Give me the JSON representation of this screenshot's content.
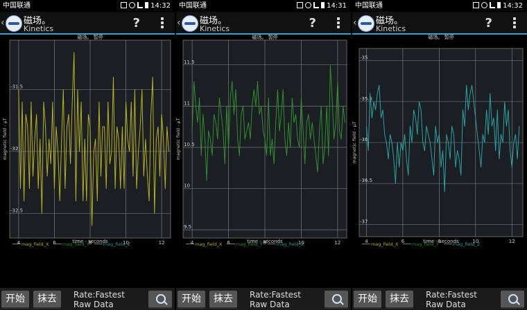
{
  "screens": [
    {
      "status": {
        "carrier": "中国联通",
        "time": "14:32"
      },
      "app": {
        "title": "磁场。",
        "subtitle": "Kinetics"
      },
      "chart_data": {
        "type": "line",
        "title": "磁场。 暂停",
        "xlabel": "time - seconds",
        "ylabel": "magnetic field - µT",
        "xlim": [
          3.5,
          12.5
        ],
        "ylim": [
          -32.7,
          -31.1
        ],
        "xticks": [
          4,
          6,
          8,
          10,
          12
        ],
        "yticks": [
          -31.5,
          -32,
          -32.5
        ],
        "ytick_labels": [
          "-31.5",
          "-32",
          "-32.5"
        ],
        "legend": [
          "mag_field_X",
          "mag_field_Y",
          "mag_field_Z"
        ],
        "series": [
          {
            "name": "mag_field_X",
            "color": "#b7b21f",
            "x": [
              4.0,
              4.1,
              4.2,
              4.3,
              4.4,
              4.5,
              4.6,
              4.7,
              4.8,
              4.9,
              5.0,
              5.1,
              5.2,
              5.3,
              5.4,
              5.5,
              5.6,
              5.7,
              5.8,
              5.9,
              6.0,
              6.1,
              6.2,
              6.3,
              6.4,
              6.5,
              6.6,
              6.7,
              6.8,
              6.9,
              7.0,
              7.1,
              7.2,
              7.3,
              7.4,
              7.5,
              7.6,
              7.7,
              7.8,
              7.9,
              8.0,
              8.1,
              8.2,
              8.3,
              8.4,
              8.5,
              8.6,
              8.7,
              8.8,
              8.9,
              9.0,
              9.1,
              9.2,
              9.3,
              9.4,
              9.5,
              9.6,
              9.7,
              9.8,
              9.9,
              10.0,
              10.1,
              10.2,
              10.3,
              10.4,
              10.5,
              10.6,
              10.7,
              10.8,
              10.9,
              11.0,
              11.1,
              11.2,
              11.3,
              11.4,
              11.5,
              11.6,
              11.7,
              11.8,
              11.9,
              12.0,
              12.1,
              12.2,
              12.3,
              12.4
            ],
            "y": [
              -31.5,
              -32.3,
              -31.6,
              -32.4,
              -31.7,
              -31.8,
              -32.3,
              -31.6,
              -32.2,
              -31.9,
              -31.7,
              -32.3,
              -31.9,
              -32.5,
              -31.6,
              -31.8,
              -32.2,
              -31.9,
              -32.1,
              -31.6,
              -32.3,
              -31.8,
              -32.0,
              -32.4,
              -31.9,
              -31.5,
              -32.3,
              -31.8,
              -31.7,
              -32.1,
              -31.6,
              -31.2,
              -32.4,
              -31.5,
              -32.0,
              -31.6,
              -32.4,
              -31.9,
              -32.4,
              -31.7,
              -31.8,
              -32.6,
              -32.0,
              -31.9,
              -32.4,
              -31.6,
              -32.2,
              -31.8,
              -31.8,
              -32.3,
              -31.6,
              -32.1,
              -32.0,
              -31.4,
              -32.3,
              -31.8,
              -31.9,
              -32.3,
              -31.8,
              -32.3,
              -31.6,
              -31.9,
              -32.0,
              -31.6,
              -32.2,
              -31.5,
              -32.3,
              -32.0,
              -31.8,
              -31.5,
              -32.2,
              -31.9,
              -32.2,
              -32.4,
              -31.7,
              -31.4,
              -32.5,
              -31.9,
              -31.8,
              -32.2,
              -31.7,
              -31.9,
              -32.3,
              -31.8,
              -32.0
            ]
          },
          {
            "name": "mag_field_Y",
            "color": "#2a8a2a",
            "x": [],
            "y": []
          },
          {
            "name": "mag_field_Z",
            "color": "#2a9a9a",
            "x": [],
            "y": []
          }
        ]
      },
      "controls": {
        "start": "开始",
        "clear": "抹去",
        "rate": "Rate:Fastest",
        "mode": "Raw Data"
      }
    },
    {
      "status": {
        "carrier": "中国联通",
        "time": "14:31"
      },
      "app": {
        "title": "磁场。",
        "subtitle": "Kinetics"
      },
      "chart_data": {
        "type": "line",
        "title": "磁场。 暂停",
        "xlabel": "time - seconds",
        "ylabel": "magnetic field - µT",
        "xlim": [
          3.5,
          12.5
        ],
        "ylim": [
          9.4,
          11.8
        ],
        "xticks": [
          4,
          6,
          8,
          10,
          12
        ],
        "yticks": [
          11.5,
          11,
          10.5,
          10,
          9.5
        ],
        "ytick_labels": [
          "11.5",
          "11",
          "10.5",
          "10",
          "9.5"
        ],
        "legend": [
          "mag_field_X",
          "mag_field_Y",
          "mag_field_Z"
        ],
        "series": [
          {
            "name": "mag_field_X",
            "color": "#b7b21f",
            "x": [],
            "y": []
          },
          {
            "name": "mag_field_Y",
            "color": "#2f8f2f",
            "x": [
              4.0,
              4.1,
              4.2,
              4.3,
              4.4,
              4.5,
              4.6,
              4.7,
              4.8,
              4.9,
              5.0,
              5.1,
              5.2,
              5.3,
              5.4,
              5.5,
              5.6,
              5.7,
              5.8,
              5.9,
              6.0,
              6.1,
              6.2,
              6.3,
              6.4,
              6.5,
              6.6,
              6.7,
              6.8,
              6.9,
              7.0,
              7.1,
              7.2,
              7.3,
              7.4,
              7.5,
              7.6,
              7.7,
              7.8,
              7.9,
              8.0,
              8.1,
              8.2,
              8.3,
              8.4,
              8.5,
              8.6,
              8.7,
              8.8,
              8.9,
              9.0,
              9.1,
              9.2,
              9.3,
              9.4,
              9.5,
              9.6,
              9.7,
              9.8,
              9.9,
              10.0,
              10.1,
              10.2,
              10.3,
              10.4,
              10.5,
              10.6,
              10.7,
              10.8,
              10.9,
              11.0,
              11.1,
              11.2,
              11.3,
              11.4,
              11.5,
              11.6,
              11.7,
              11.8,
              11.9,
              12.0,
              12.1,
              12.2,
              12.3,
              12.4
            ],
            "y": [
              10.7,
              11.3,
              11.0,
              10.8,
              11.1,
              10.4,
              10.9,
              10.6,
              10.1,
              10.7,
              10.6,
              10.4,
              10.9,
              10.8,
              10.6,
              11.1,
              10.9,
              10.7,
              10.3,
              11.0,
              10.5,
              11.1,
              11.3,
              10.9,
              11.2,
              10.6,
              10.4,
              10.9,
              11.0,
              10.6,
              10.7,
              10.8,
              10.6,
              11.0,
              11.2,
              11.0,
              11.3,
              10.9,
              11.0,
              10.7,
              10.6,
              10.4,
              11.1,
              10.4,
              10.6,
              10.3,
              10.8,
              11.2,
              10.7,
              10.9,
              11.2,
              10.6,
              10.4,
              10.8,
              10.5,
              11.1,
              10.8,
              10.9,
              10.6,
              10.5,
              11.1,
              10.7,
              10.3,
              10.8,
              10.9,
              10.6,
              10.8,
              10.6,
              10.4,
              10.2,
              10.7,
              11.0,
              10.3,
              10.5,
              11.0,
              10.4,
              11.5,
              11.1,
              10.6,
              10.8,
              11.3,
              10.7,
              10.6,
              11.0,
              10.8
            ]
          },
          {
            "name": "mag_field_Z",
            "color": "#2a9a9a",
            "x": [],
            "y": []
          }
        ]
      },
      "controls": {
        "start": "开始",
        "clear": "抹去",
        "rate": "Rate:Fastest",
        "mode": "Raw Data"
      }
    },
    {
      "status": {
        "carrier": "中国联通",
        "time": "14:32"
      },
      "app": {
        "title": "磁场。",
        "subtitle": "Kinetics"
      },
      "chart_data": {
        "type": "line",
        "title": "磁场。 暂停",
        "xlabel": "time - seconds",
        "ylabel": "magnetic field - µT",
        "xlim": [
          3.6,
          12.6
        ],
        "ylim": [
          -37.15,
          -34.85
        ],
        "xticks": [
          4,
          6,
          8,
          10,
          12
        ],
        "yticks": [
          -35,
          -35.5,
          -36,
          -36.5,
          -37
        ],
        "ytick_labels": [
          "-35",
          "-35.5",
          "-36",
          "-36.5",
          "-37"
        ],
        "legend": [
          "mag_field_X",
          "mag_field_Y",
          "mag_field_Z"
        ],
        "series": [
          {
            "name": "mag_field_X",
            "color": "#b7b21f",
            "x": [],
            "y": []
          },
          {
            "name": "mag_field_Y",
            "color": "#2a8a2a",
            "x": [],
            "y": []
          },
          {
            "name": "mag_field_Z",
            "color": "#2aa3a3",
            "x": [
              4.0,
              4.1,
              4.2,
              4.3,
              4.4,
              4.5,
              4.6,
              4.7,
              4.8,
              4.9,
              5.0,
              5.1,
              5.2,
              5.3,
              5.4,
              5.5,
              5.6,
              5.7,
              5.8,
              5.9,
              6.0,
              6.1,
              6.2,
              6.3,
              6.4,
              6.5,
              6.6,
              6.7,
              6.8,
              6.9,
              7.0,
              7.1,
              7.2,
              7.3,
              7.4,
              7.5,
              7.6,
              7.7,
              7.8,
              7.9,
              8.0,
              8.1,
              8.2,
              8.3,
              8.4,
              8.5,
              8.6,
              8.7,
              8.8,
              8.9,
              9.0,
              9.1,
              9.2,
              9.3,
              9.4,
              9.5,
              9.6,
              9.7,
              9.8,
              9.9,
              10.0,
              10.1,
              10.2,
              10.3,
              10.4,
              10.5,
              10.6,
              10.7,
              10.8,
              10.9,
              11.0,
              11.1,
              11.2,
              11.3,
              11.4,
              11.5,
              11.6,
              11.7,
              11.8,
              11.9,
              12.0,
              12.1,
              12.2,
              12.3,
              12.4
            ],
            "y": [
              -35.8,
              -36.1,
              -35.4,
              -35.7,
              -35.5,
              -35.6,
              -35.4,
              -35.3,
              -35.7,
              -35.6,
              -35.9,
              -36.0,
              -36.2,
              -35.9,
              -36.0,
              -36.2,
              -36.5,
              -36.0,
              -36.3,
              -36.0,
              -36.1,
              -35.9,
              -36.2,
              -36.4,
              -35.8,
              -36.0,
              -35.6,
              -35.7,
              -35.9,
              -35.5,
              -35.6,
              -36.0,
              -36.1,
              -35.8,
              -35.9,
              -36.0,
              -36.2,
              -36.4,
              -35.8,
              -36.0,
              -35.9,
              -36.3,
              -36.1,
              -36.6,
              -35.9,
              -36.0,
              -36.2,
              -35.8,
              -35.9,
              -36.3,
              -36.1,
              -36.2,
              -36.4,
              -35.6,
              -35.8,
              -35.3,
              -35.6,
              -35.4,
              -35.3,
              -35.5,
              -35.7,
              -35.9,
              -36.1,
              -36.3,
              -35.9,
              -36.0,
              -35.6,
              -35.9,
              -35.4,
              -35.8,
              -35.7,
              -36.1,
              -35.6,
              -36.2,
              -35.9,
              -36.0,
              -35.5,
              -35.8,
              -35.6,
              -36.1,
              -36.3,
              -36.0,
              -35.9,
              -36.2,
              -35.8
            ]
          }
        ]
      },
      "controls": {
        "start": "开始",
        "clear": "抹去",
        "rate": "Rate:Fastest",
        "mode": "Raw Data"
      }
    }
  ]
}
